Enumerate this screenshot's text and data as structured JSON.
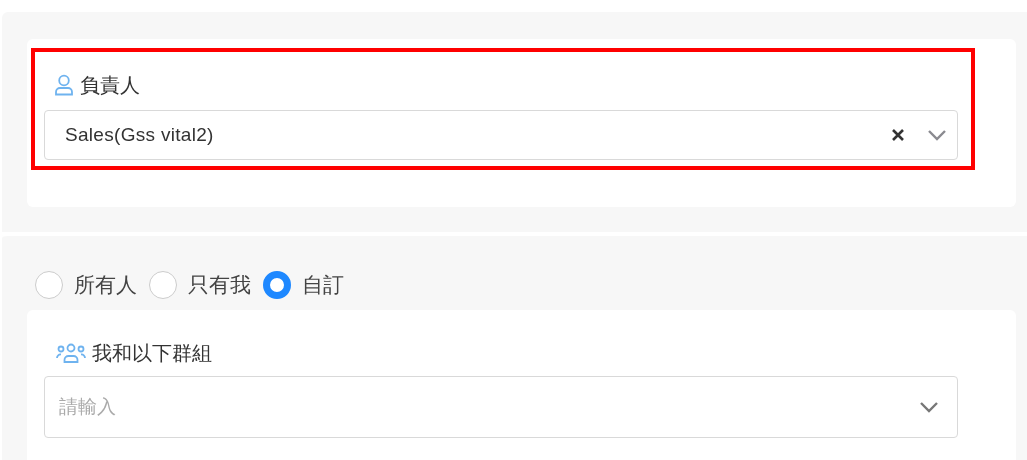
{
  "owner_field": {
    "label": "負責人",
    "value": "Sales(Gss vital2)",
    "highlighted": true,
    "clearable": true
  },
  "visibility": {
    "options": [
      {
        "label": "所有人",
        "selected": false
      },
      {
        "label": "只有我",
        "selected": false
      },
      {
        "label": "自訂",
        "selected": true
      }
    ]
  },
  "group_field": {
    "label": "我和以下群組",
    "placeholder": "請輸入"
  }
}
